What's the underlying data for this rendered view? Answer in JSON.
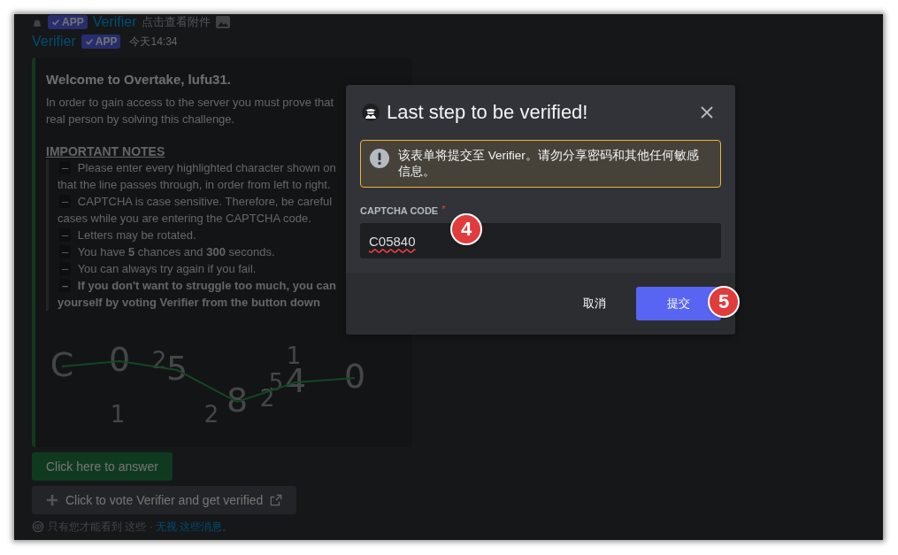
{
  "message_preview": {
    "badge": "APP",
    "author": "Verifier",
    "text": "点击查看附件"
  },
  "message": {
    "author": "Verifier",
    "badge": "APP",
    "timestamp": "今天14:34",
    "embed": {
      "title": "Welcome to Overtake, lufu31.",
      "intro_lines": [
        "In order to gain access to the server you must prove that",
        "real person by solving this challenge."
      ],
      "notes_heading": "IMPORTANT NOTES",
      "notes": [
        {
          "bullet": "–",
          "bold": false,
          "lines": [
            "Please enter every highlighted character shown on",
            "that the line passes through, in order from left to right."
          ]
        },
        {
          "bullet": "–",
          "bold": false,
          "lines": [
            "CAPTCHA is case sensitive. Therefore, be careful",
            "cases while you are entering the CAPTCHA code."
          ]
        },
        {
          "bullet": "–",
          "bold": false,
          "lines": [
            "Letters may be rotated."
          ]
        },
        {
          "bullet": "–",
          "bold": false,
          "lines": [
            "You have **5** chances and **300** seconds."
          ]
        },
        {
          "bullet": "–",
          "bold": false,
          "lines": [
            "You can always try again if you fail."
          ]
        },
        {
          "bullet": "–",
          "bold": true,
          "lines": [
            "If you don't want to struggle too much, you can",
            "yourself by voting Verifier from the button down"
          ]
        }
      ]
    },
    "captcha": {
      "characters": [
        {
          "text": "C",
          "kind": "main"
        },
        {
          "text": "0",
          "kind": "main"
        },
        {
          "text": "5",
          "kind": "main"
        },
        {
          "text": "8",
          "kind": "main"
        },
        {
          "text": "4",
          "kind": "main"
        },
        {
          "text": "0",
          "kind": "main"
        },
        {
          "text": "2",
          "kind": "noise"
        },
        {
          "text": "1",
          "kind": "noise"
        },
        {
          "text": "2",
          "kind": "noise"
        },
        {
          "text": "2",
          "kind": "noise"
        },
        {
          "text": "1",
          "kind": "noise"
        },
        {
          "text": "5",
          "kind": "noise"
        }
      ]
    },
    "buttons": [
      {
        "label": "Click here to answer",
        "kind": "success"
      },
      {
        "label": "Click to vote Verifier and get verified",
        "kind": "link"
      }
    ],
    "ephemeral_note": {
      "text": "只有您才能看到 这些 · ",
      "link": "无视 这些消息",
      "end": "。"
    }
  },
  "modal": {
    "title": "Last step to be verified!",
    "warning": "该表单将提交至 Verifier。请勿分享密码和其他任何敏感信息。",
    "field": {
      "label": "CAPTCHA CODE",
      "required_mark": "*",
      "value": "C05840",
      "spelling_error": true
    },
    "buttons": [
      {
        "label": "取消",
        "kind": "link"
      },
      {
        "label": "提交",
        "kind": "primary"
      }
    ]
  },
  "step_markers": [
    {
      "label": "4"
    },
    {
      "label": "5"
    }
  ]
}
